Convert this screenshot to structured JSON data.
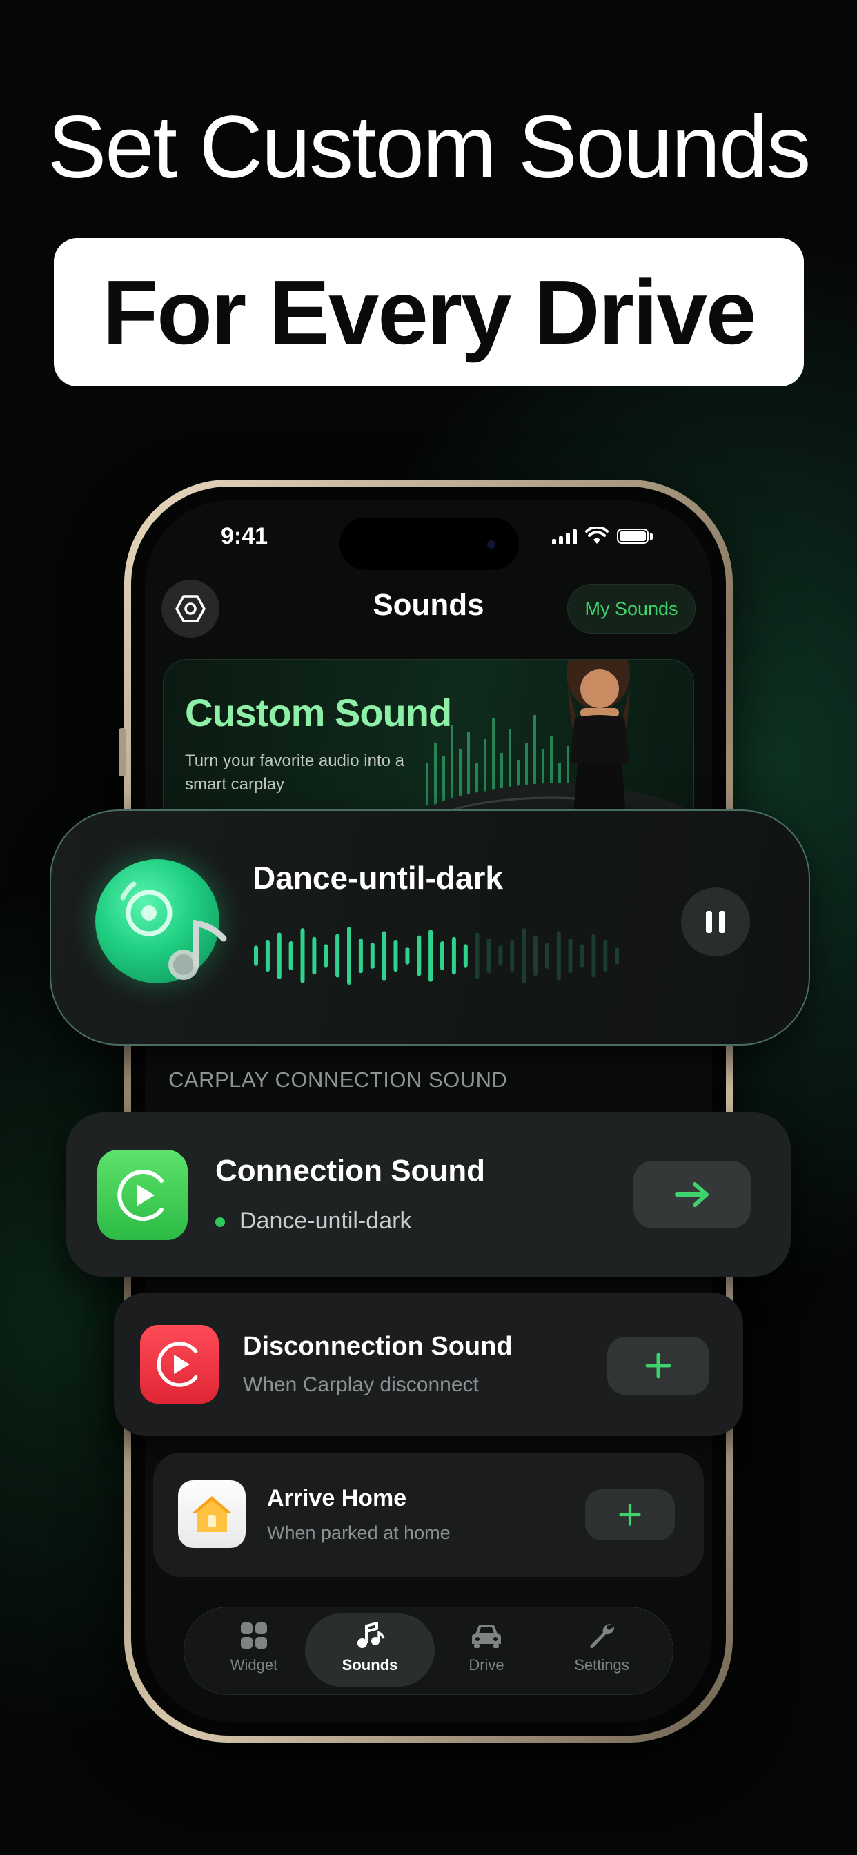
{
  "promo": {
    "headline": "Set Custom Sounds",
    "subheadline": "For Every Drive"
  },
  "status_bar": {
    "time": "9:41"
  },
  "header": {
    "title": "Sounds",
    "my_sounds_label": "My Sounds"
  },
  "banner": {
    "title": "Custom Sound",
    "subtitle": "Turn your favorite audio into a smart carplay"
  },
  "now_playing": {
    "title": "Dance-until-dark",
    "progress": 0.58
  },
  "section": {
    "label": "CARPLAY CONNECTION SOUND"
  },
  "cards": {
    "connection": {
      "title": "Connection Sound",
      "subtitle": "Dance-until-dark"
    },
    "disconnection": {
      "title": "Disconnection Sound",
      "subtitle": "When Carplay disconnect"
    },
    "arrive_home": {
      "title": "Arrive Home",
      "subtitle": "When parked at home"
    }
  },
  "tabs": [
    {
      "label": "Widget",
      "icon": "widget-grid-icon",
      "active": false
    },
    {
      "label": "Sounds",
      "icon": "music-note-icon",
      "active": true
    },
    {
      "label": "Drive",
      "icon": "car-icon",
      "active": false
    },
    {
      "label": "Settings",
      "icon": "wrench-icon",
      "active": false
    }
  ],
  "colors": {
    "accent_green": "#3ed36c",
    "connection_icon": "#2cbb45",
    "disconnection_icon": "#e02535",
    "wave_active": "#2fd38e",
    "wave_inactive": "#1c3b31"
  }
}
